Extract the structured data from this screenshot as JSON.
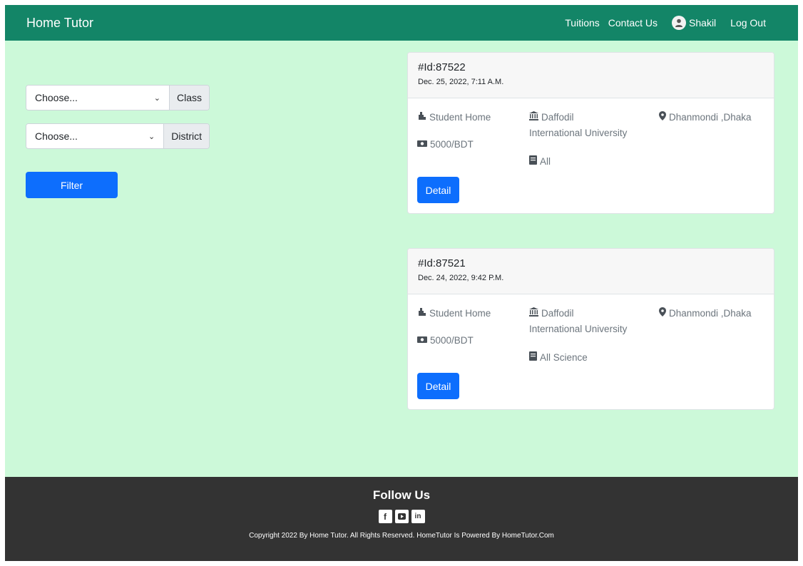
{
  "navbar": {
    "brand": "Home Tutor",
    "links": [
      "Tuitions",
      "Contact Us"
    ],
    "user": "Shakil",
    "logout": "Log Out"
  },
  "filters": {
    "class": {
      "value": "Choose...",
      "label": "Class"
    },
    "district": {
      "value": "Choose...",
      "label": "District"
    },
    "button": "Filter"
  },
  "tuitions": [
    {
      "id": "#Id:87522",
      "date": "Dec. 25, 2022, 7:11 A.M.",
      "place": "Student Home",
      "salary": "5000/BDT",
      "institution_line1": "Daffodil",
      "institution_line2": "International University",
      "subject": "All",
      "location": "Dhanmondi ,Dhaka",
      "button": "Detail"
    },
    {
      "id": "#Id:87521",
      "date": "Dec. 24, 2022, 9:42 P.M.",
      "place": "Student Home",
      "salary": "5000/BDT",
      "institution_line1": "Daffodil",
      "institution_line2": "International University",
      "subject": "All Science",
      "location": "Dhanmondi ,Dhaka",
      "button": "Detail"
    }
  ],
  "footer": {
    "title": "Follow Us",
    "socials": [
      "facebook-icon",
      "youtube-icon",
      "linkedin-icon"
    ],
    "copyright": "Copyright 2022 By Home Tutor. All Rights Reserved. HomeTutor Is Powered By HomeTutor.Com"
  },
  "colors": {
    "navbar": "#138567",
    "page_bg": "#ccf9d9",
    "primary_button": "#0d6efd",
    "footer": "#333333"
  }
}
